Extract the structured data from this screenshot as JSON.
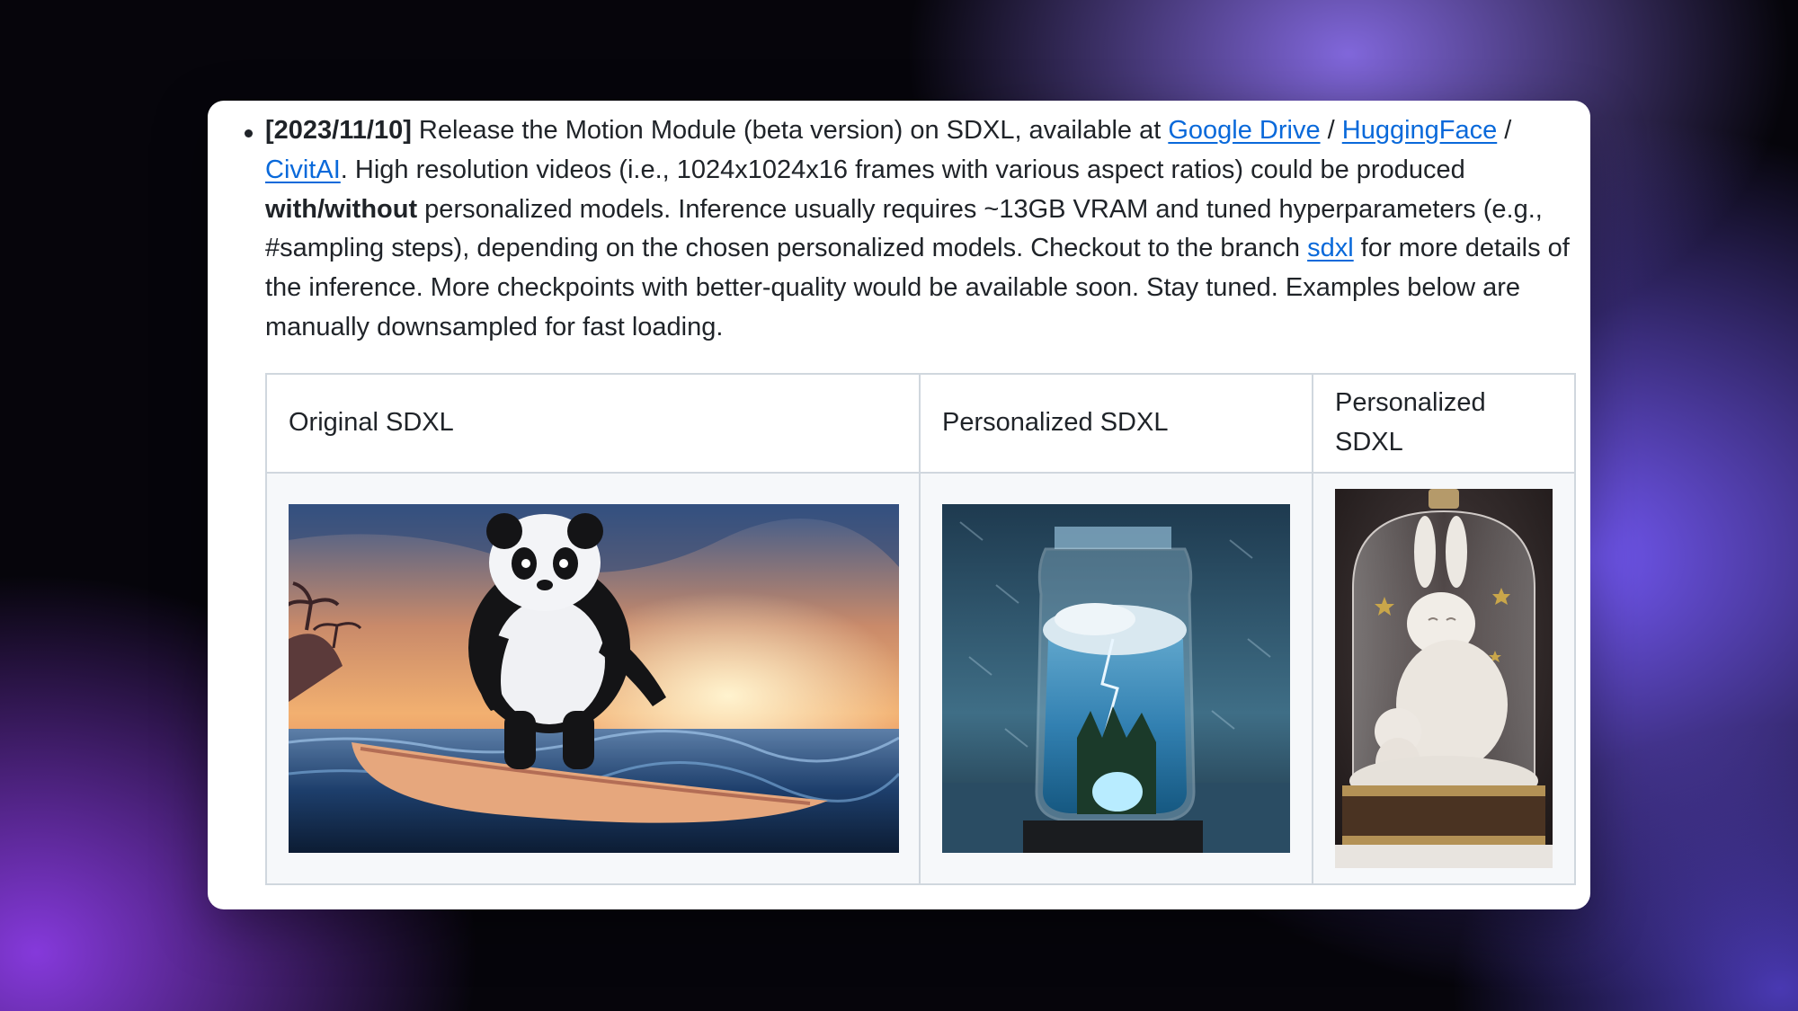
{
  "post": {
    "date": "[2023/11/10]",
    "t1": " Release the Motion Module (beta version) on SDXL, available at ",
    "link_google_drive": "Google Drive",
    "sep1": " / ",
    "link_huggingface": "HuggingFace",
    "sep2": " / ",
    "link_civitai": "CivitAI",
    "t2": ". High resolution videos (i.e., 1024x1024x16 frames with various aspect ratios) could be produced ",
    "bold_with_without": "with/without",
    "t3": " personalized models. Inference usually requires ~13GB VRAM and tuned hyperparameters (e.g., #sampling steps), depending on the chosen personalized models. Checkout to the branch ",
    "link_sdxl": "sdxl",
    "t4": " for more details of the inference. More checkpoints with better-quality would be available soon. Stay tuned. Examples below are manually downsampled for fast loading."
  },
  "table": {
    "headers": [
      "Original SDXL",
      "Personalized SDXL",
      "Personalized SDXL"
    ]
  },
  "colors": {
    "link": "#0969da",
    "text": "#1f2328",
    "border": "#d0d7de",
    "cell_bg": "#f6f8fa"
  }
}
